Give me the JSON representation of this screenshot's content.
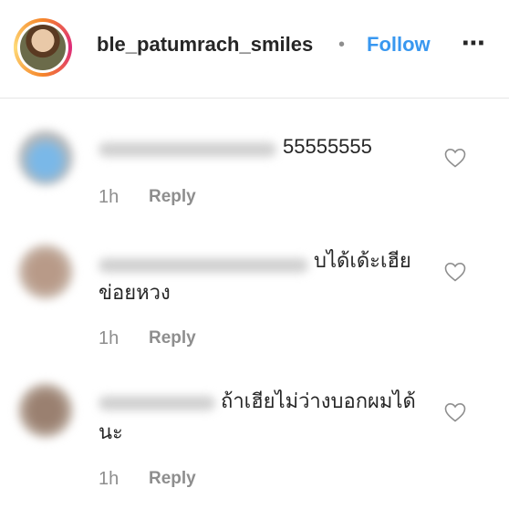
{
  "header": {
    "username": "ble_patumrach_smiles",
    "separator": "•",
    "follow_label": "Follow",
    "more_icon": "⋯"
  },
  "comments": [
    {
      "text": "55555555",
      "time": "1h",
      "reply": "Reply"
    },
    {
      "text_line1": "บได้เด้ะเฮีย",
      "text_line2": "ข่อยหวง",
      "time": "1h",
      "reply": "Reply"
    },
    {
      "text_line1": "ถ้าเฮียไม่ว่างบอกผมได้",
      "text_line2": "นะ",
      "time": "1h",
      "reply": "Reply"
    }
  ],
  "colors": {
    "follow": "#3897f0",
    "meta": "#8e8e8e",
    "text": "#262626"
  }
}
